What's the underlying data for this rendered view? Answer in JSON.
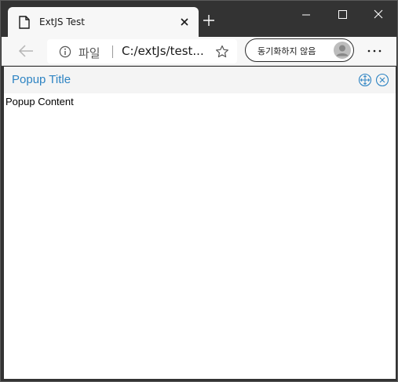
{
  "browser": {
    "tab": {
      "title": "ExtJS Test",
      "icon": "page-icon"
    },
    "window_controls": [
      "minimize-icon",
      "maximize-icon",
      "close-icon"
    ],
    "address_bar": {
      "scheme_label": "파일",
      "url": "C:/extJs/test..."
    },
    "sync_button": {
      "label": "동기화하지 않음"
    },
    "colors": {
      "frame": "#333333",
      "toolbar": "#f7f7f7"
    }
  },
  "popup": {
    "title": "Popup Title",
    "content": "Popup Content",
    "tools": [
      "move-icon",
      "close-circle-icon"
    ],
    "colors": {
      "title": "#2e84c3",
      "header": "#f4f4f4",
      "tool": "#2e84c3"
    }
  }
}
